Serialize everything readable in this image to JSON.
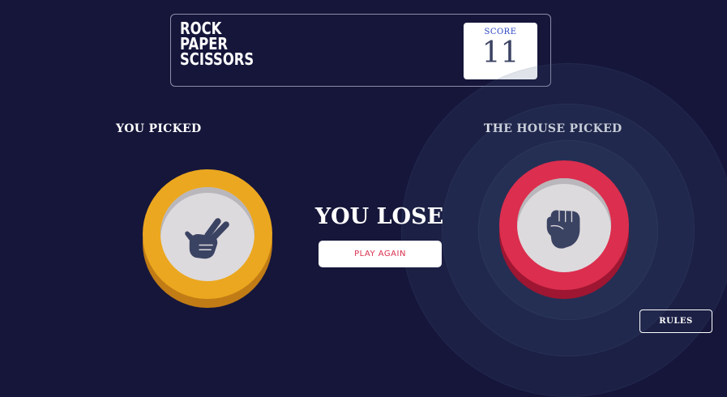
{
  "header": {
    "logo_lines": [
      "ROCK",
      "PAPER",
      "SCISSORS"
    ],
    "score_label": "SCORE",
    "score_value": "11"
  },
  "player": {
    "heading": "YOU PICKED",
    "choice": "scissors",
    "icon": "scissors-hand-icon",
    "ring_color": "#eba71f"
  },
  "house": {
    "heading": "THE HOUSE PICKED",
    "choice": "rock",
    "icon": "rock-fist-icon",
    "ring_color": "#dc2e4e"
  },
  "result": {
    "text": "YOU LOSE",
    "play_again_label": "PLAY AGAIN"
  },
  "rules": {
    "label": "RULES"
  },
  "colors": {
    "background": "#16163b",
    "accent_red": "#db2e4d",
    "score_label_blue": "#2a45c2",
    "score_value_dark": "#3b4363"
  }
}
